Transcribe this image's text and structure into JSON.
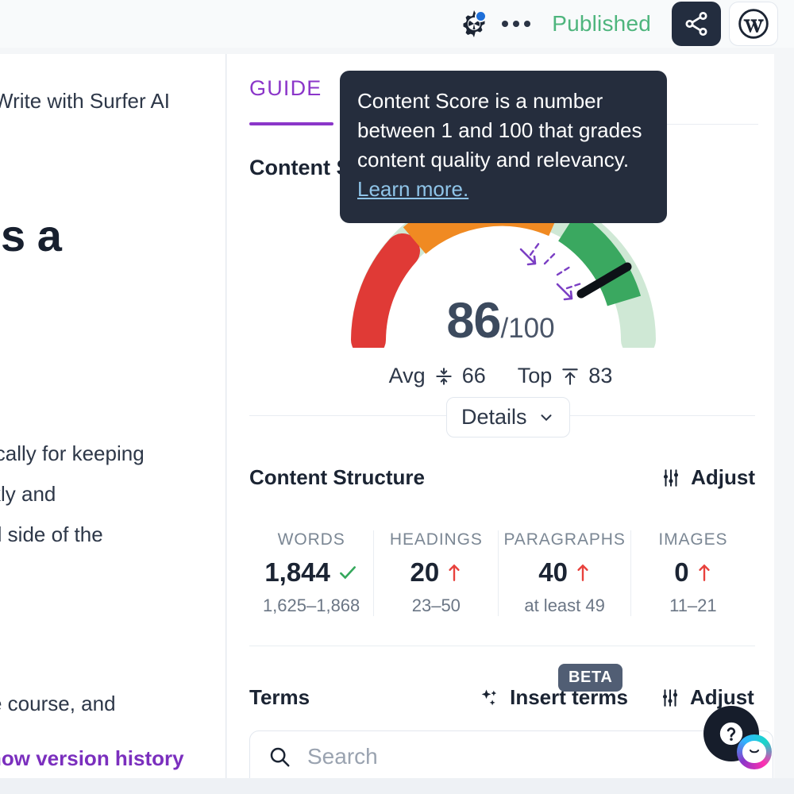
{
  "topbar": {
    "gear_icon": "gear-icon",
    "notification_dot": "blue",
    "more_icon": "ellipsis-icon",
    "status": "Published",
    "status_color": "#4eb57d",
    "share_icon": "share-icon",
    "wordpress_icon": "wordpress-icon"
  },
  "document": {
    "ai_label": "Write with Surfer AI",
    "heading_fragment": "is a",
    "paragraph_lines": [
      "ically for keeping",
      "kly and",
      "d side of the",
      "e course, and"
    ],
    "version_link": "how version history",
    "link_color": "#7b2fbe"
  },
  "guide": {
    "tab_label": "GUIDE",
    "accent_color": "#8b36c9",
    "content_score_title": "Content Score",
    "score": {
      "value": "86",
      "denominator": "/100",
      "max": 100,
      "avg_label": "Avg",
      "avg_value": "66",
      "top_label": "Top",
      "top_value": "83",
      "arc_red": "#e03a36",
      "arc_orange": "#f08a22",
      "arc_green": "#3aa860",
      "arc_track": "#cfe8d5"
    },
    "details_button": "Details",
    "content_structure": {
      "title": "Content Structure",
      "adjust_label": "Adjust",
      "metrics": [
        {
          "label": "WORDS",
          "value": "1,844",
          "status": "check",
          "range": "1,625–1,868"
        },
        {
          "label": "HEADINGS",
          "value": "20",
          "status": "up",
          "range": "23–50"
        },
        {
          "label": "PARAGRAPHS",
          "value": "40",
          "status": "up",
          "range": "at least 49"
        },
        {
          "label": "IMAGES",
          "value": "0",
          "status": "up",
          "range": "11–21"
        }
      ]
    },
    "terms": {
      "title": "Terms",
      "insert_label": "Insert terms",
      "beta_badge": "BETA",
      "adjust_label": "Adjust",
      "search_placeholder": "Search"
    }
  },
  "tooltip": {
    "text": "Content Score is a number between 1 and 100 that grades content quality and relevancy. ",
    "link": "Learn more."
  },
  "help": {
    "help_icon": "question-mark-icon",
    "chat_icon": "smiley-chat-icon"
  }
}
